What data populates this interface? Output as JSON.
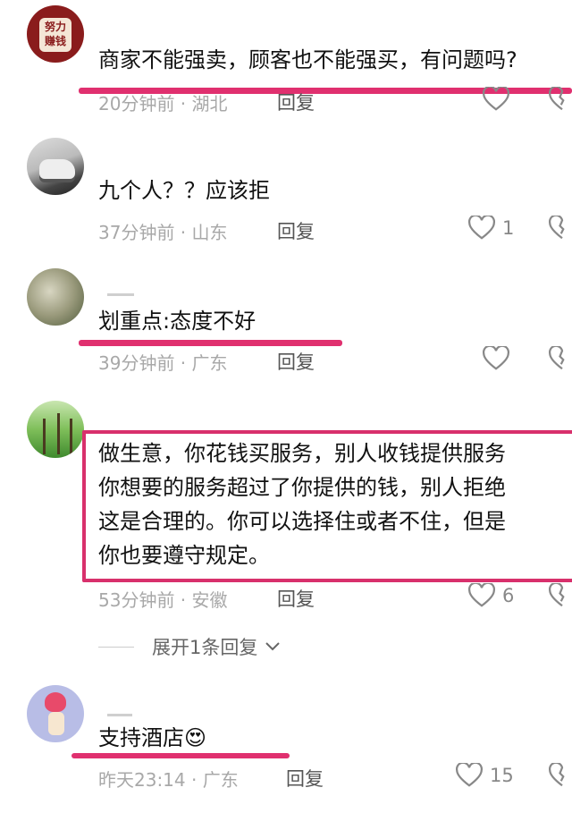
{
  "comments": [
    {
      "avatar_text_1": "努力",
      "avatar_text_2": "赚钱",
      "text": "商家不能强卖，顾客也不能强买，有问题吗?",
      "meta": "20分钟前 · 湖北",
      "reply": "回复",
      "likes": ""
    },
    {
      "text": "九个人？？应该拒",
      "meta": "37分钟前 · 山东",
      "reply": "回复",
      "likes": "1"
    },
    {
      "text": "划重点:态度不好",
      "meta": "39分钟前 · 广东",
      "reply": "回复",
      "likes": ""
    },
    {
      "lines": [
        "做生意，你花钱买服务，别人收钱提供服务",
        "你想要的服务超过了你提供的钱，别人拒绝",
        "这是合理的。你可以选择住或者不住，但是",
        "你也要遵守规定。"
      ],
      "meta": "53分钟前 · 安徽",
      "reply": "回复",
      "likes": "6",
      "expand": "展开1条回复"
    },
    {
      "text": "支持酒店",
      "emoji": "😍",
      "meta": "昨天23:14 · 广东",
      "reply": "回复",
      "likes": "15"
    }
  ],
  "colors": {
    "highlight": "#e0306f",
    "meta": "#a8a8a8"
  }
}
